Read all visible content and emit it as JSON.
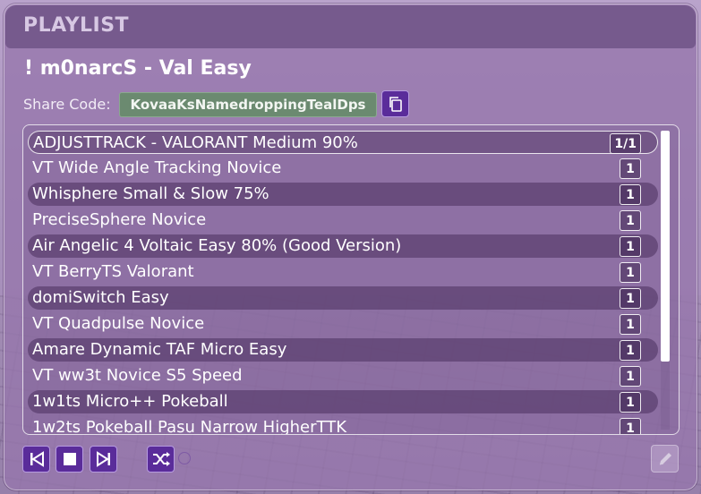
{
  "header": {
    "title": "PLAYLIST"
  },
  "playlist": {
    "name": "! m0narcS - Val Easy",
    "share_label": "Share Code:",
    "share_code": "KovaaKsNamedroppingTealDps"
  },
  "scenarios": [
    {
      "name": "ADJUSTTRACK - VALORANT Medium 90%",
      "count": "1/1"
    },
    {
      "name": "VT Wide Angle Tracking Novice",
      "count": "1"
    },
    {
      "name": "Whisphere Small & Slow 75%",
      "count": "1"
    },
    {
      "name": "PreciseSphere Novice",
      "count": "1"
    },
    {
      "name": "Air Angelic 4 Voltaic Easy 80% (Good Version)",
      "count": "1"
    },
    {
      "name": "VT BerryTS Valorant",
      "count": "1"
    },
    {
      "name": "domiSwitch Easy",
      "count": "1"
    },
    {
      "name": "VT Quadpulse Novice",
      "count": "1"
    },
    {
      "name": "Amare Dynamic TAF Micro Easy",
      "count": "1"
    },
    {
      "name": "VT ww3t Novice S5 Speed",
      "count": "1"
    },
    {
      "name": "1w1ts Micro++ Pokeball",
      "count": "1"
    },
    {
      "name": "1w2ts Pokeball Pasu Narrow HigherTTK",
      "count": "1"
    }
  ],
  "controls": {
    "prev_icon": "skip-previous-icon",
    "stop_icon": "stop-icon",
    "next_icon": "skip-next-icon",
    "shuffle_icon": "shuffle-icon",
    "edit_icon": "pencil-icon",
    "copy_icon": "copy-icon"
  },
  "colors": {
    "accent_button": "#5a2c9a",
    "share_code_bg": "#6b8a70",
    "panel": "#9676ac"
  }
}
